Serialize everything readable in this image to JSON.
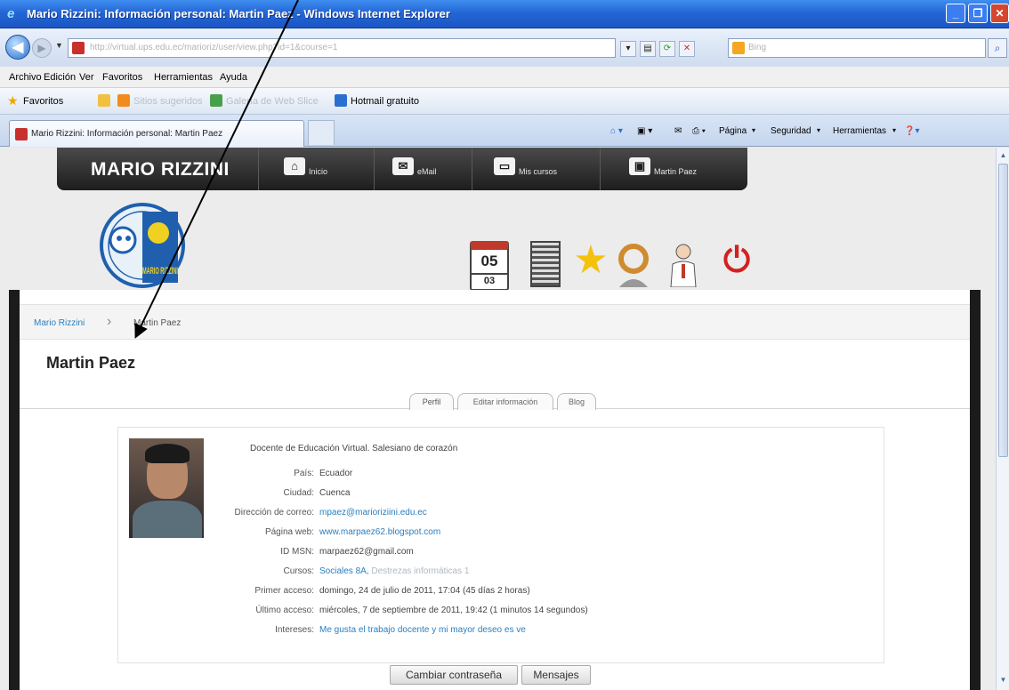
{
  "window": {
    "title": "Mario Rizzini: Información personal: Martin Paez - Windows Internet Explorer"
  },
  "address": {
    "url": "http://virtual.ups.edu.ec/marioriz/user/view.php?id=1&course=1",
    "search_placeholder": "Bing"
  },
  "menu": [
    "Archivo",
    "Edición",
    "Ver",
    "Favoritos",
    "Herramientas",
    "Ayuda"
  ],
  "favbar": {
    "favorites": "Favoritos",
    "suggested": "Sitios sugeridos",
    "gallery": "Galería de Web Slice",
    "hotmail": "Hotmail gratuito"
  },
  "tab": {
    "title": "Mario Rizzini: Información personal: Martin Paez"
  },
  "commandbar": {
    "page": "Página",
    "security": "Seguridad",
    "tools": "Herramientas"
  },
  "site": {
    "brand": "MARIO RIZZINI",
    "nav": [
      {
        "icon": "home-icon",
        "label": "Inicio"
      },
      {
        "icon": "email-icon",
        "label": "eMail"
      },
      {
        "icon": "monitor-icon",
        "label": "Mis cursos"
      },
      {
        "icon": "user-icon",
        "label": "Martin Paez"
      }
    ],
    "logo_text": "MARIO RIZZINI",
    "calendar": {
      "day": "05",
      "next": "03"
    }
  },
  "breadcrumb": {
    "home": "Mario Rizzini",
    "current": "Martin Paez"
  },
  "page_title": "Martin Paez",
  "profile_tabs": [
    "Perfil",
    "Editar información",
    "Blog"
  ],
  "profile": {
    "description": "Docente de Educación Virtual. Salesiano de corazón",
    "fields": [
      {
        "label": "País:",
        "value": "Ecuador",
        "link": false
      },
      {
        "label": "Ciudad:",
        "value": "Cuenca",
        "link": false
      },
      {
        "label": "Dirección de correo:",
        "value": "mpaez@marioriziini.edu.ec",
        "link": true
      },
      {
        "label": "Página web:",
        "value": "www.marpaez62.blogspot.com",
        "link": true
      },
      {
        "label": "ID MSN:",
        "value": "marpaez62@gmail.com",
        "link": false
      },
      {
        "label": "Cursos:",
        "value": "Sociales 8A,",
        "extra": "Destrezas informáticas 1",
        "link": true
      },
      {
        "label": "Primer acceso:",
        "value": "domingo, 24 de julio de 2011, 17:04  (45 días 2 horas)",
        "link": false
      },
      {
        "label": "Último acceso:",
        "value": "miércoles, 7 de septiembre de 2011, 19:42  (1 minutos 14 segundos)",
        "link": false
      },
      {
        "label": "Intereses:",
        "value": "Me gusta el trabajo docente y mi mayor deseo es ve",
        "link": true
      }
    ]
  },
  "buttons": {
    "change_password": "Cambiar contraseña",
    "messages": "Mensajes"
  },
  "colors": {
    "accent": "#2a7fbf",
    "nav_bg": "#1d1d1d",
    "titlebar": "#2466d6"
  }
}
